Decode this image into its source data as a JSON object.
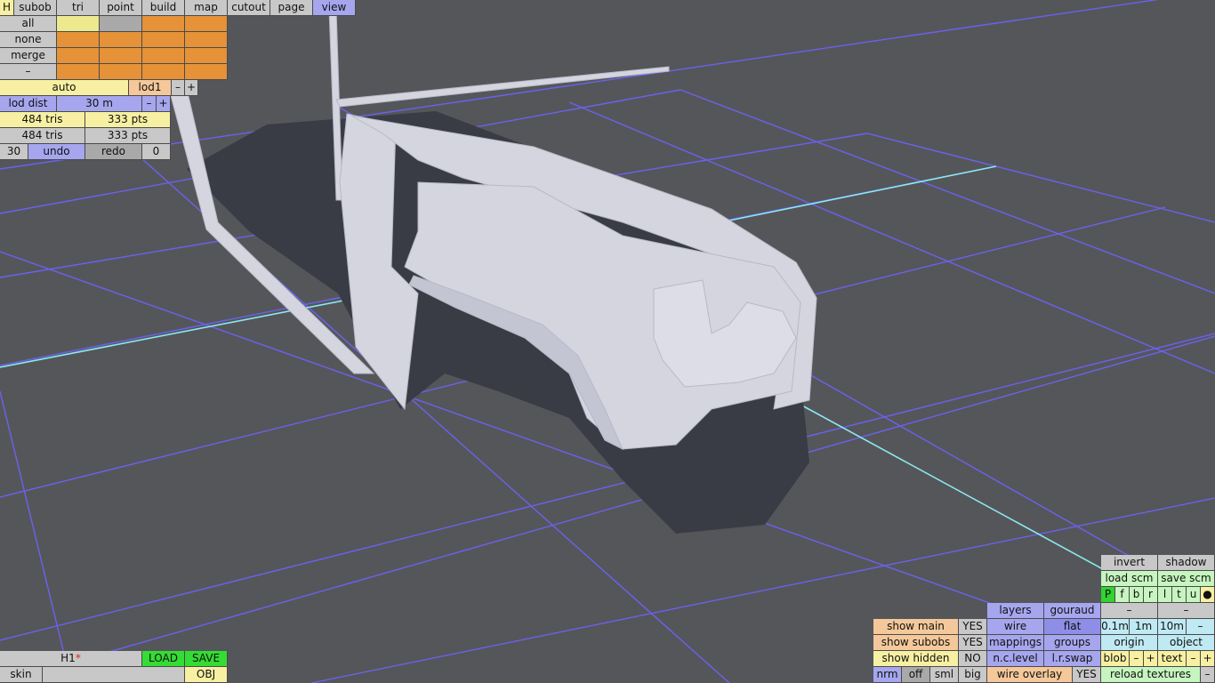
{
  "toolbar": {
    "h_label": "H",
    "modes": [
      "subob",
      "tri",
      "point",
      "build",
      "map",
      "cutout",
      "page",
      "view"
    ]
  },
  "select_panel": {
    "labels": [
      "all",
      "none",
      "merge",
      "–"
    ]
  },
  "lod": {
    "auto": "auto",
    "lod_name": "lod1",
    "minus": "–",
    "plus": "+",
    "dist_label": "lod dist",
    "dist_value": "30 m",
    "dist_minus": "–",
    "dist_plus": "+"
  },
  "stats": {
    "row1_tris": "484 tris",
    "row1_pts": "333 pts",
    "row2_tris": "484 tris",
    "row2_pts": "333 pts"
  },
  "history": {
    "undo_count": "30",
    "undo": "undo",
    "redo": "redo",
    "redo_count": "0"
  },
  "file": {
    "name": "H1",
    "modified_mark": "*",
    "load": "LOAD",
    "save": "SAVE",
    "skin": "skin",
    "obj": "OBJ"
  },
  "view_options": {
    "show_main": "show main",
    "show_main_val": "YES",
    "show_subobs": "show subobs",
    "show_subobs_val": "YES",
    "show_hidden": "show hidden",
    "show_hidden_val": "NO",
    "layers": "layers",
    "gouraud": "gouraud",
    "wire": "wire",
    "flat": "flat",
    "mappings": "mappings",
    "groups": "groups",
    "nc_level": "n.c.level",
    "lr_swap": "l.r.swap",
    "wire_overlay": "wire overlay",
    "wire_overlay_val": "YES",
    "sizes": [
      "nrm",
      "off",
      "sml",
      "big"
    ]
  },
  "right_panel": {
    "invert": "invert",
    "shadow": "shadow",
    "load_scm": "load scm",
    "save_scm": "save scm",
    "views": [
      "P",
      "f",
      "b",
      "r",
      "l",
      "t",
      "u",
      "●"
    ],
    "dash1": "–",
    "dash2": "–",
    "steps": [
      "0.1m",
      "1m",
      "10m",
      "–"
    ],
    "origin": "origin",
    "object": "object",
    "blob": "blob",
    "blob_minus": "–",
    "blob_plus": "+",
    "text": "text",
    "text_minus": "–",
    "text_plus": "+",
    "reload_textures": "reload textures",
    "reload_minus": "–"
  },
  "colors": {
    "background": "#55565a",
    "grid": "#6a62ee",
    "axis": "#8ae8f0",
    "model": "#d4d5df",
    "shadow": "#3a3c45"
  }
}
